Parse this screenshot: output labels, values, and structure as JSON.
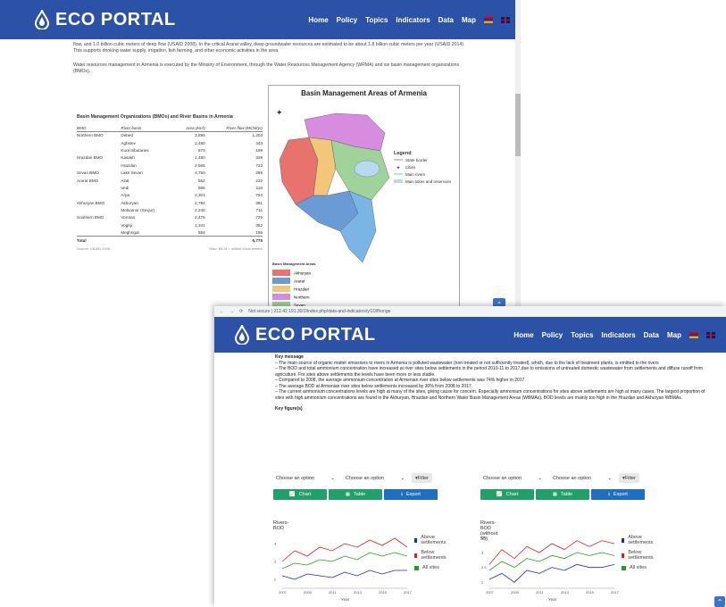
{
  "brand": {
    "name": "ECO PORTAL"
  },
  "nav": [
    "Home",
    "Policy",
    "Topics",
    "Indicators",
    "Data",
    "Map"
  ],
  "page1": {
    "p1": "flow, and 1.0 billion cubic meters of deep flow (USAID 2008). In the critical Ararat valley, deep groundwater resources are estimated to be about 1.8 billion cubic meters per year (USAID 2014). This supports drinking water supply, irrigation, fish farming, and other economic activities in the area.",
    "p2": "Water resources management in Armenia is executed by the Ministry of Environment, through the Water Resources Management Agency (WRMA) and six basin management organizations (BMOs).",
    "table": {
      "title": "Basin Management Organizations (BMOs) and River Basins in Armenia",
      "headers": [
        "BMO",
        "River basin",
        "Area (km²)",
        "River flow (MCM/yr)"
      ],
      "rows": [
        [
          "Northern BMO",
          "Debed",
          "3,895",
          "1,203"
        ],
        [
          "",
          "Aghstev",
          "2,480",
          "443"
        ],
        [
          "",
          "Kura tributaries",
          "870",
          "199"
        ],
        [
          "Hrazdan BMO",
          "Kasakh",
          "1,480",
          "329"
        ],
        [
          "",
          "Hrazdan",
          "2,565",
          "733"
        ],
        [
          "Sevan BMO",
          "Lake Sevan",
          "4,750",
          "265"
        ],
        [
          "Ararat BMO",
          "Azat",
          "552",
          "232"
        ],
        [
          "",
          "Vedi",
          "586",
          "110"
        ],
        [
          "",
          "Arpa",
          "2,301",
          "764"
        ],
        [
          "Akhuryan BMO",
          "Akhuryan",
          "2,784",
          "391"
        ],
        [
          "",
          "Metsamor (Sevjur)",
          "2,240",
          "711"
        ],
        [
          "Southern BMO",
          "Vorotan",
          "2,476",
          "725"
        ],
        [
          "",
          "Voghji",
          "1,341",
          "352"
        ],
        [
          "",
          "Meghrigat",
          "684",
          "196"
        ]
      ],
      "total": [
        "Total",
        "",
        "",
        "6,775"
      ],
      "source": "Source: USAID 2008",
      "note": "Note: MCM = million cubic meters"
    },
    "map": {
      "title": "Basin Management Areas of Armenia",
      "legend_title": "Legend",
      "legend": [
        "State border",
        "Cities",
        "Main rivers",
        "Main lakes and reservoirs"
      ],
      "bma_title": "Basin Management Areas",
      "bma": [
        {
          "name": "Akhuryan",
          "color": "#e8736e"
        },
        {
          "name": "Ararat",
          "color": "#6b9bd6"
        },
        {
          "name": "Hrazdan",
          "color": "#f2c77a"
        },
        {
          "name": "Northern",
          "color": "#d88ce0"
        },
        {
          "name": "Sevan",
          "color": "#9fd39a"
        },
        {
          "name": "Southern",
          "color": "#7ab5e6"
        }
      ]
    }
  },
  "page2": {
    "url": "Not secure | 212.42.191.30/2/index.php/data-and-indicators/y/10/fhonge",
    "key_message": "Key message",
    "bullets": [
      "– The main source of organic matter emissions to rivers in Armenia is polluted wastewater (non treated or not sufficiently treated), which, due to the lack of treatment plants, is emitted to the rivers",
      "– The BOD and total ammonium concentration have increased at river sites below settlements in the period 2010-11 to 2017,due to emissions of untreated domestic wastewater from settlements and diffuse runoff from agriculture. For sites above settlements the levels have been more or less stable.",
      "– Compared to 2008, the average ammonium concentration at Armenian river sites below settlements was 74% higher in 2017.",
      "– The average BOD at Armenian river sites below settlements increased by 30% from 2008 to 2017.",
      "– The current ammonium concentrations levels are high at many of the sites, giving cause for concern. Especially ammonium concentrations for sites above settlements are high at many cases. The largest proportion of sites with high ammonium concentrations are found in the Akhuryan, Hrazdan and Northern Water Basin Management Areas (WBMAs). BOD levels are mainly too high in the Hrazdan and Akhuryan WBMAs."
    ],
    "key_figures": "Key figure(s)",
    "controls": {
      "opt": "Choose an option",
      "filter": "Filter",
      "chart": "Chart",
      "table": "Table",
      "export": "Export"
    },
    "xlabel": "Year"
  },
  "chart_data": [
    {
      "type": "line",
      "title": "Rivers-BOD",
      "x": [
        "2007",
        "2008",
        "2009",
        "2010",
        "2011",
        "2012",
        "2013",
        "2014",
        "2015",
        "2016",
        "2017"
      ],
      "ylim": [
        1.5,
        4.5
      ],
      "yticks": [
        "2",
        "3",
        "4"
      ],
      "xticks": [
        "2007",
        "2009",
        "2011",
        "2013",
        "2015",
        "2017"
      ],
      "series": [
        {
          "name": "Above settlements",
          "color": "#2424d6",
          "values": [
            2.2,
            2.0,
            2.3,
            2.2,
            2.1,
            2.4,
            2.2,
            2.5,
            2.3,
            2.5,
            2.5
          ]
        },
        {
          "name": "Below settlements",
          "color": "#e02020",
          "values": [
            3.0,
            3.6,
            3.3,
            3.8,
            3.6,
            4.0,
            3.8,
            4.2,
            3.9,
            4.3,
            3.8
          ]
        },
        {
          "name": "All sites",
          "color": "#20a020",
          "values": [
            2.6,
            2.9,
            2.8,
            3.1,
            3.0,
            3.3,
            3.1,
            3.5,
            3.3,
            3.5,
            3.3
          ]
        }
      ]
    },
    {
      "type": "line",
      "title": "Rivers-BOD (without 55)",
      "x": [
        "2007",
        "2008",
        "2009",
        "2010",
        "2011",
        "2012",
        "2013",
        "2014",
        "2015",
        "2016",
        "2017"
      ],
      "ylim": [
        1.8,
        3.6
      ],
      "yticks": [
        "2",
        "2.5",
        "3",
        "3.5"
      ],
      "xticks": [
        "2007",
        "2009",
        "2011",
        "2013",
        "2015",
        "2017"
      ],
      "series": [
        {
          "name": "Above settlements",
          "color": "#2424d6",
          "values": [
            2.1,
            2.3,
            2.0,
            2.4,
            2.3,
            2.5,
            2.4,
            2.6,
            2.5,
            2.5,
            2.6
          ]
        },
        {
          "name": "Below settlements",
          "color": "#e02020",
          "values": [
            2.6,
            3.1,
            2.8,
            3.2,
            3.0,
            3.3,
            3.1,
            3.4,
            3.2,
            3.4,
            3.3
          ]
        },
        {
          "name": "All sites",
          "color": "#20a020",
          "values": [
            2.4,
            2.7,
            2.5,
            2.8,
            2.7,
            2.9,
            2.8,
            3.0,
            2.9,
            3.0,
            2.9
          ]
        }
      ]
    }
  ]
}
